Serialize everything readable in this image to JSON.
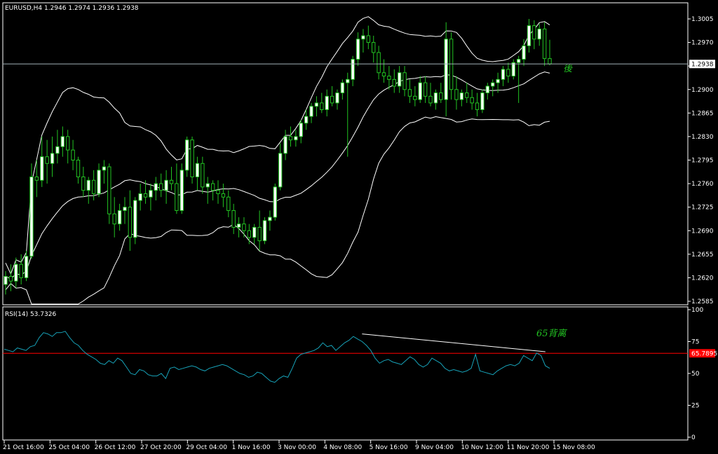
{
  "chart_data": [
    {
      "type": "candlestick",
      "title": "EURUSD,H4  1.2946 1.2974 1.2936 1.2938",
      "symbol": "EURUSD,H4",
      "last_price": "1.2938",
      "y_ticks": [
        "1.3005",
        "1.2970",
        "1.2935",
        "1.2900",
        "1.2865",
        "1.2830",
        "1.2795",
        "1.2760",
        "1.2725",
        "1.2690",
        "1.2655",
        "1.2620",
        "1.2585"
      ],
      "ylim": [
        1.2585,
        1.3005
      ],
      "x_ticks": [
        "21 Oct 16:00",
        "25 Oct 04:00",
        "26 Oct 12:00",
        "27 Oct 20:00",
        "29 Oct 04:00",
        "1 Nov 16:00",
        "3 Nov 00:00",
        "4 Nov 08:00",
        "5 Nov 16:00",
        "9 Nov 04:00",
        "10 Nov 12:00",
        "11 Nov 20:00",
        "15 Nov 08:00"
      ],
      "horizontal_line": 1.2938,
      "indicator": "Bollinger Bands",
      "annotation": "後",
      "colors": {
        "bull": "#ffffff",
        "bear": "#000000",
        "wick": "#22c322",
        "bands": "#ffffff",
        "hline": "#9fb0b5"
      },
      "candles": [
        [
          1.261,
          1.263,
          1.2595,
          1.2622
        ],
        [
          1.2622,
          1.264,
          1.26,
          1.2615
        ],
        [
          1.2615,
          1.265,
          1.2605,
          1.264
        ],
        [
          1.264,
          1.2655,
          1.261,
          1.262
        ],
        [
          1.262,
          1.266,
          1.2615,
          1.2652
        ],
        [
          1.2652,
          1.279,
          1.2648,
          1.277
        ],
        [
          1.277,
          1.2795,
          1.274,
          1.2765
        ],
        [
          1.2765,
          1.283,
          1.2755,
          1.28
        ],
        [
          1.28,
          1.2825,
          1.276,
          1.279
        ],
        [
          1.279,
          1.283,
          1.277,
          1.2805
        ],
        [
          1.2805,
          1.284,
          1.279,
          1.2815
        ],
        [
          1.2815,
          1.2845,
          1.28,
          1.283
        ],
        [
          1.283,
          1.284,
          1.279,
          1.281
        ],
        [
          1.281,
          1.2825,
          1.278,
          1.2795
        ],
        [
          1.2795,
          1.28,
          1.276,
          1.277
        ],
        [
          1.277,
          1.2785,
          1.274,
          1.275
        ],
        [
          1.275,
          1.277,
          1.273,
          1.2765
        ],
        [
          1.2765,
          1.278,
          1.2735,
          1.2745
        ],
        [
          1.2745,
          1.279,
          1.274,
          1.278
        ],
        [
          1.278,
          1.2795,
          1.276,
          1.2785
        ],
        [
          1.2785,
          1.279,
          1.27,
          1.2715
        ],
        [
          1.2715,
          1.274,
          1.268,
          1.27
        ],
        [
          1.27,
          1.273,
          1.269,
          1.272
        ],
        [
          1.272,
          1.274,
          1.27,
          1.2725
        ],
        [
          1.2725,
          1.275,
          1.266,
          1.268
        ],
        [
          1.268,
          1.274,
          1.267,
          1.2735
        ],
        [
          1.2735,
          1.276,
          1.272,
          1.2745
        ],
        [
          1.2745,
          1.2765,
          1.273,
          1.274
        ],
        [
          1.274,
          1.276,
          1.272,
          1.275
        ],
        [
          1.275,
          1.277,
          1.2735,
          1.276
        ],
        [
          1.276,
          1.2775,
          1.274,
          1.275
        ],
        [
          1.275,
          1.278,
          1.273,
          1.2765
        ],
        [
          1.2765,
          1.2785,
          1.275,
          1.276
        ],
        [
          1.276,
          1.279,
          1.2715,
          1.272
        ],
        [
          1.272,
          1.279,
          1.2715,
          1.278
        ],
        [
          1.278,
          1.283,
          1.277,
          1.2825
        ],
        [
          1.2825,
          1.283,
          1.276,
          1.277
        ],
        [
          1.277,
          1.28,
          1.275,
          1.279
        ],
        [
          1.279,
          1.28,
          1.2745,
          1.2755
        ],
        [
          1.2755,
          1.277,
          1.273,
          1.276
        ],
        [
          1.276,
          1.2765,
          1.2735,
          1.275
        ],
        [
          1.275,
          1.2765,
          1.273,
          1.2745
        ],
        [
          1.2745,
          1.276,
          1.2725,
          1.274
        ],
        [
          1.274,
          1.275,
          1.271,
          1.272
        ],
        [
          1.272,
          1.273,
          1.2685,
          1.2695
        ],
        [
          1.2695,
          1.271,
          1.268,
          1.27
        ],
        [
          1.27,
          1.271,
          1.268,
          1.269
        ],
        [
          1.269,
          1.27,
          1.267,
          1.268
        ],
        [
          1.268,
          1.27,
          1.267,
          1.2695
        ],
        [
          1.2695,
          1.272,
          1.266,
          1.2675
        ],
        [
          1.2675,
          1.271,
          1.267,
          1.2705
        ],
        [
          1.2705,
          1.272,
          1.269,
          1.271
        ],
        [
          1.271,
          1.276,
          1.2705,
          1.2755
        ],
        [
          1.2755,
          1.282,
          1.275,
          1.2805
        ],
        [
          1.2805,
          1.284,
          1.2795,
          1.283
        ],
        [
          1.283,
          1.2845,
          1.2815,
          1.2825
        ],
        [
          1.2825,
          1.284,
          1.2815,
          1.283
        ],
        [
          1.283,
          1.2855,
          1.282,
          1.285
        ],
        [
          1.285,
          1.287,
          1.284,
          1.286
        ],
        [
          1.286,
          1.288,
          1.285,
          1.2875
        ],
        [
          1.2875,
          1.289,
          1.286,
          1.288
        ],
        [
          1.288,
          1.2895,
          1.2865,
          1.287
        ],
        [
          1.287,
          1.29,
          1.286,
          1.289
        ],
        [
          1.289,
          1.2905,
          1.2875,
          1.288
        ],
        [
          1.288,
          1.29,
          1.287,
          1.2895
        ],
        [
          1.2895,
          1.2915,
          1.2885,
          1.291
        ],
        [
          1.291,
          1.2925,
          1.28,
          1.2915
        ],
        [
          1.2915,
          1.295,
          1.2905,
          1.2945
        ],
        [
          1.2945,
          1.2985,
          1.2935,
          1.2975
        ],
        [
          1.2975,
          1.299,
          1.2955,
          1.298
        ],
        [
          1.298,
          1.2995,
          1.296,
          1.297
        ],
        [
          1.297,
          1.298,
          1.294,
          1.2955
        ],
        [
          1.2955,
          1.2965,
          1.2915,
          1.2925
        ],
        [
          1.2925,
          1.2945,
          1.291,
          1.292
        ],
        [
          1.292,
          1.2935,
          1.29,
          1.2915
        ],
        [
          1.2915,
          1.293,
          1.2895,
          1.2905
        ],
        [
          1.2905,
          1.2935,
          1.2895,
          1.2925
        ],
        [
          1.2925,
          1.2935,
          1.289,
          1.29
        ],
        [
          1.29,
          1.2915,
          1.288,
          1.289
        ],
        [
          1.289,
          1.2905,
          1.2875,
          1.2885
        ],
        [
          1.2885,
          1.292,
          1.288,
          1.291
        ],
        [
          1.291,
          1.292,
          1.288,
          1.289
        ],
        [
          1.289,
          1.291,
          1.2875,
          1.288
        ],
        [
          1.288,
          1.29,
          1.287,
          1.2895
        ],
        [
          1.2895,
          1.291,
          1.288,
          1.2885
        ],
        [
          1.2885,
          1.3,
          1.286,
          1.2975
        ],
        [
          1.2975,
          1.2985,
          1.2885,
          1.29
        ],
        [
          1.29,
          1.292,
          1.287,
          1.2885
        ],
        [
          1.2885,
          1.29,
          1.2875,
          1.2895
        ],
        [
          1.2895,
          1.291,
          1.288,
          1.2888
        ],
        [
          1.2888,
          1.29,
          1.287,
          1.288
        ],
        [
          1.288,
          1.2895,
          1.286,
          1.287
        ],
        [
          1.287,
          1.29,
          1.2865,
          1.2895
        ],
        [
          1.2895,
          1.291,
          1.2885,
          1.2905
        ],
        [
          1.2905,
          1.2915,
          1.289,
          1.291
        ],
        [
          1.291,
          1.2925,
          1.2895,
          1.2915
        ],
        [
          1.2915,
          1.2935,
          1.2905,
          1.293
        ],
        [
          1.293,
          1.294,
          1.291,
          1.292
        ],
        [
          1.292,
          1.2945,
          1.2915,
          1.294
        ],
        [
          1.294,
          1.295,
          1.288,
          1.2945
        ],
        [
          1.2945,
          1.2975,
          1.2935,
          1.2965
        ],
        [
          1.2965,
          1.3005,
          1.2955,
          1.2995
        ],
        [
          1.2995,
          1.3003,
          1.296,
          1.2975
        ],
        [
          1.2975,
          1.2998,
          1.2965,
          1.299
        ],
        [
          1.299,
          1.3,
          1.2935,
          1.2946
        ],
        [
          1.2946,
          1.2974,
          1.2936,
          1.2938
        ]
      ]
    },
    {
      "type": "line",
      "title": "RSI(14) 53.7326",
      "y_ticks": [
        "100",
        "75",
        "50",
        "25",
        "0"
      ],
      "ylim": [
        0,
        100
      ],
      "level": 65.7895,
      "level_label": "65.7895",
      "annotation": "65背离",
      "colors": {
        "line": "#17a2b8",
        "level": "#ff0000",
        "trend": "#ffffff"
      },
      "trendline": [
        [
          82,
          81
        ],
        [
          124,
          67
        ]
      ],
      "values": [
        69,
        68,
        67,
        70,
        69,
        68,
        71,
        72,
        78,
        82,
        81,
        79,
        82,
        82,
        83,
        78,
        74,
        72,
        68,
        65,
        63,
        61,
        58,
        57,
        60,
        58,
        62,
        60,
        55,
        50,
        49,
        53,
        52,
        49,
        48,
        48,
        50,
        46,
        54,
        55,
        53,
        54,
        55,
        56,
        55,
        53,
        52,
        54,
        55,
        56,
        57,
        56,
        54,
        52,
        50,
        49,
        47,
        48,
        51,
        50,
        47,
        44,
        43,
        46,
        48,
        47,
        54,
        62,
        65,
        66,
        67,
        68,
        70,
        74,
        71,
        72,
        68,
        71,
        74,
        76,
        79,
        77,
        75,
        72,
        68,
        62,
        58,
        60,
        61,
        59,
        58,
        57,
        60,
        63,
        61,
        57,
        55,
        57,
        62,
        60,
        58,
        54,
        52,
        53,
        52,
        51,
        52,
        54,
        65,
        52,
        51,
        50,
        49,
        52,
        54,
        56,
        57,
        56,
        58,
        64,
        62,
        60,
        66,
        64,
        56,
        54
      ]
    }
  ]
}
